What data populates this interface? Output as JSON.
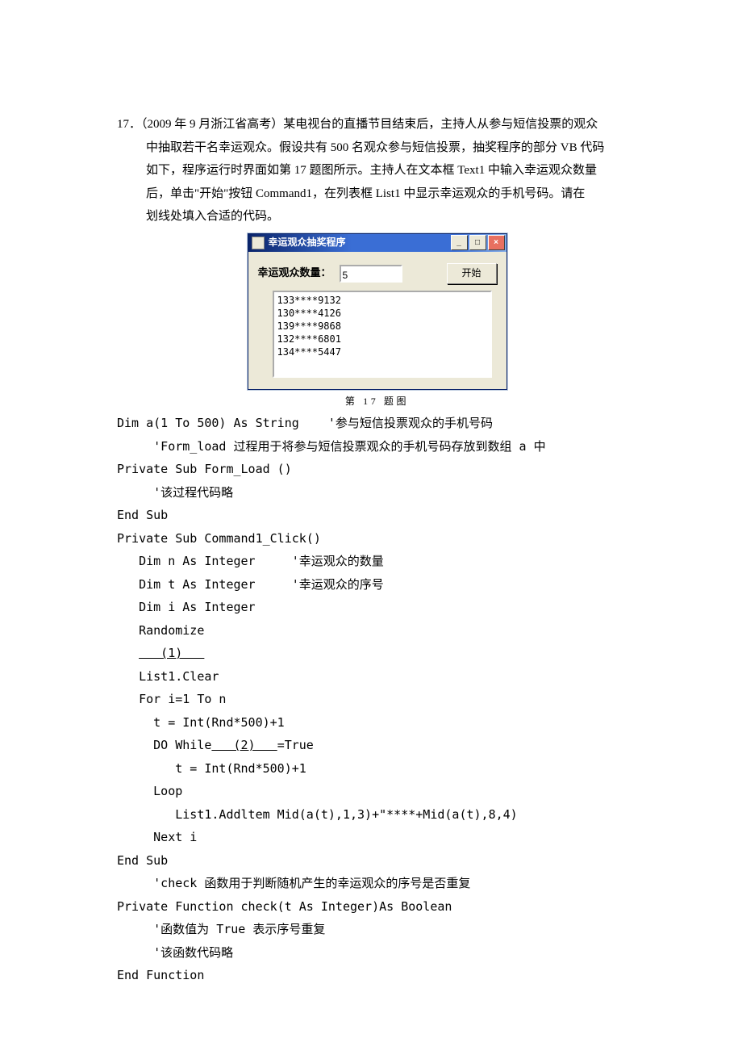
{
  "q": {
    "num": "17．",
    "stem1": "（2009 年 9 月浙江省高考）某电视台的直播节目结束后，主持人从参与短信投票的观众",
    "stem2": "中抽取若干名幸运观众。假设共有 500 名观众参与短信投票，抽奖程序的部分 VB 代码",
    "stem3": "如下，程序运行时界面如第 17 题图所示。主持人在文本框 Text1 中输入幸运观众数量",
    "stem4": "后，单击\"开始\"按钮 Command1，在列表框 List1 中显示幸运观众的手机号码。请在",
    "stem5": "划线处填入合适的代码。"
  },
  "win": {
    "title": "幸运观众抽奖程序",
    "min": "_",
    "max": "□",
    "close": "×",
    "label": "幸运观众数量：",
    "textval": "5",
    "btn": "开始",
    "list": [
      "133****9132",
      "130****4126",
      "139****9868",
      "132****6801",
      "134****5447"
    ]
  },
  "caption": "第 17 题图",
  "code": {
    "l1a": "Dim a(1 To 500) As String    ",
    "l1b": "'参与短信投票观众的手机号码",
    "l2": "     'Form_load 过程用于将参与短信投票观众的手机号码存放到数组 a 中",
    "l3": "Private Sub Form_Load ()",
    "l4": "     '该过程代码略",
    "l5": "End Sub",
    "l6": "Private Sub Command1_Click()",
    "l7": "   Dim n As Integer     '幸运观众的数量",
    "l8": "   Dim t As Integer     '幸运观众的序号",
    "l9": "   Dim i As Integer",
    "l10": "   Randomize",
    "l11a": "   ",
    "blank1": "   (1)   ",
    "l12": "   List1.Clear",
    "l13": "   For i=1 To n",
    "l14": "     t = Int(Rnd*500)+1",
    "l15a": "     DO While",
    "blank2": "   (2)   ",
    "l15b": "=True",
    "l16": "        t = Int(Rnd*500)+1",
    "l17": "     Loop",
    "l18": "        List1.Addltem Mid(a(t),1,3)+\"****+Mid(a(t),8,4)",
    "l19": "     Next i",
    "l20": "End Sub",
    "l21": "     'check 函数用于判断随机产生的幸运观众的序号是否重复",
    "l22": "Private Function check(t As Integer)As Boolean",
    "l23": "     '函数值为 True 表示序号重复",
    "l24": "     '该函数代码略",
    "l25": "End Function"
  }
}
